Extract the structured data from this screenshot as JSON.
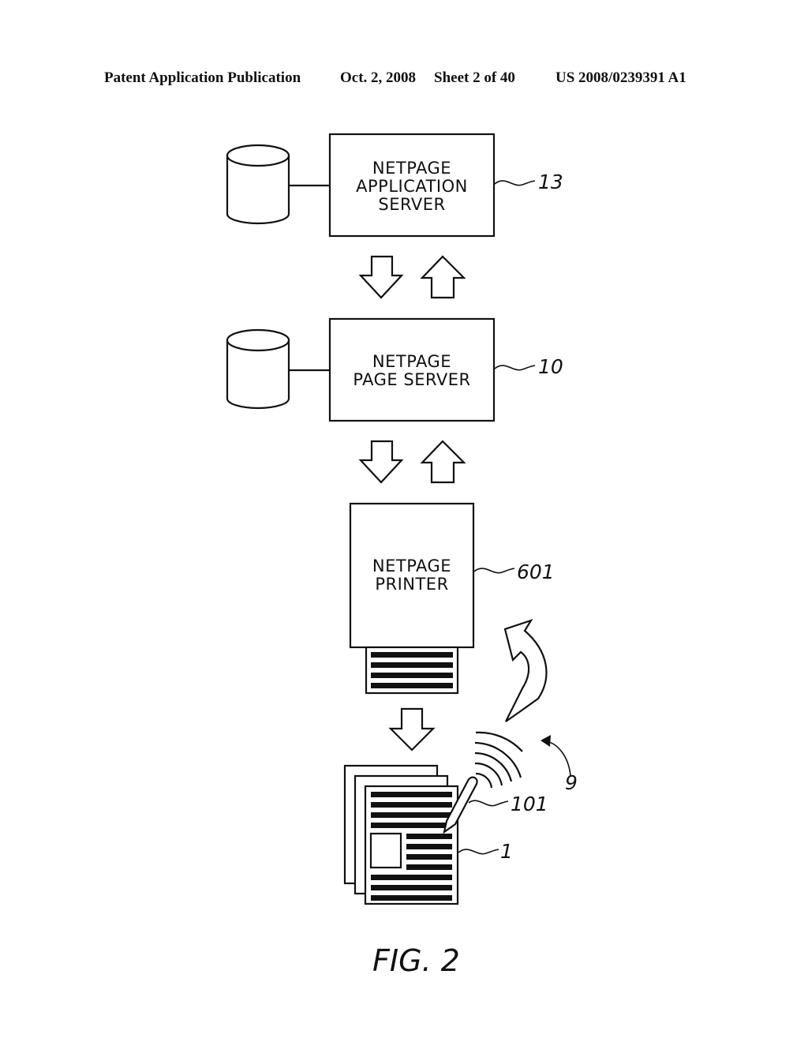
{
  "header": {
    "publication": "Patent Application Publication",
    "date": "Oct. 2, 2008",
    "sheet": "Sheet 2 of 40",
    "number": "US 2008/0239391 A1"
  },
  "diagram": {
    "nodes": [
      {
        "id": "app-server",
        "lines": [
          "NETPAGE",
          "APPLICATION",
          "SERVER"
        ],
        "ref": "13",
        "has_database": true
      },
      {
        "id": "page-server",
        "lines": [
          "NETPAGE",
          "PAGE SERVER"
        ],
        "ref": "10",
        "has_database": true
      },
      {
        "id": "printer",
        "lines": [
          "NETPAGE",
          "PRINTER"
        ],
        "ref": "601"
      }
    ],
    "other_refs": {
      "pen": "101",
      "netpage": "1",
      "interaction": "9"
    },
    "edges": [
      {
        "from": "app-server",
        "to": "page-server",
        "type": "bidirectional-block-arrows"
      },
      {
        "from": "page-server",
        "to": "printer",
        "type": "bidirectional-block-arrows"
      },
      {
        "from": "printer",
        "to": "netpage",
        "type": "block-arrow-down"
      },
      {
        "from": "pen",
        "to": "printer",
        "type": "curved-block-arrow"
      }
    ],
    "caption": "FIG. 2"
  }
}
